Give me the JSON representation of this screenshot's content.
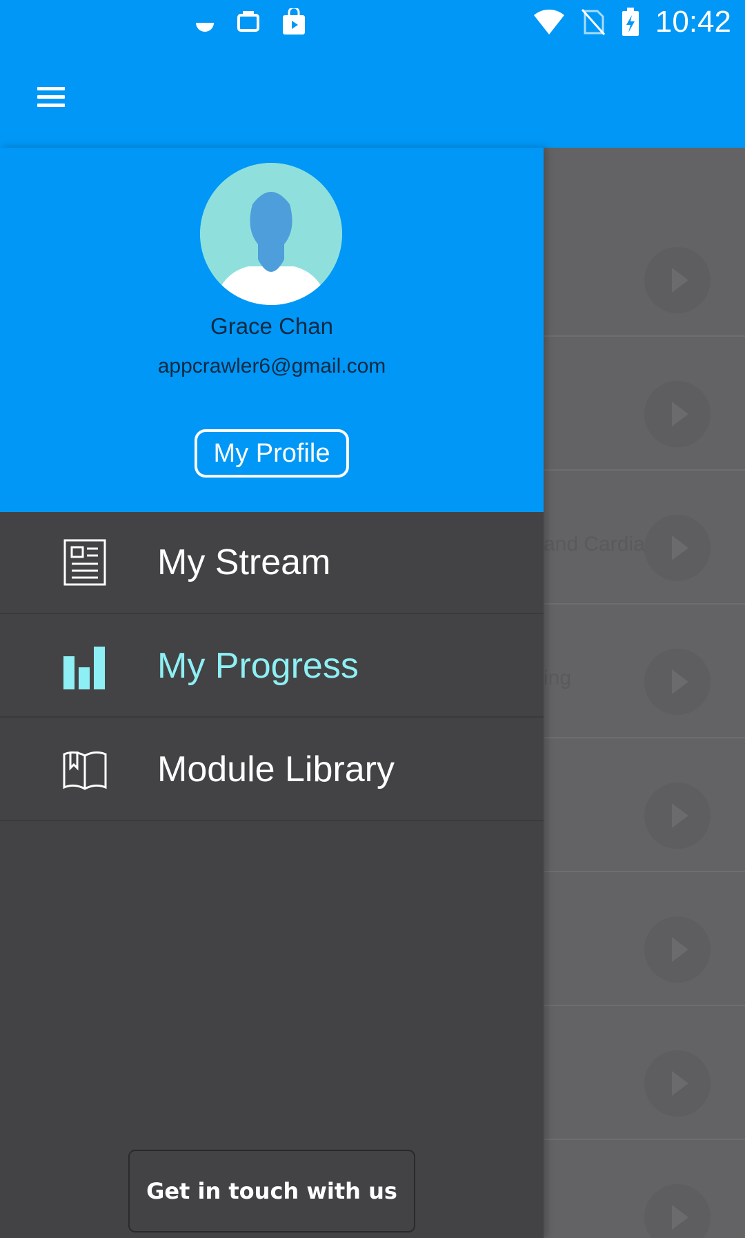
{
  "status_bar": {
    "time": "10:42",
    "icons_left": [
      "notification-icon",
      "screenshot-icon",
      "store-icon"
    ],
    "icons_right": [
      "wifi-icon",
      "no-sim-icon",
      "battery-charging-icon"
    ]
  },
  "toolbar": {
    "menu_icon": "hamburger-menu-icon"
  },
  "background_list": {
    "rows": [
      {
        "text": ""
      },
      {
        "text": ""
      },
      {
        "text": "and Cardiac"
      },
      {
        "text": "ing"
      },
      {
        "text": ""
      },
      {
        "text": ""
      },
      {
        "text": ""
      },
      {
        "text": ""
      }
    ]
  },
  "drawer": {
    "header": {
      "avatar_icon": "user-avatar-icon",
      "name": "Grace Chan",
      "email": "appcrawler6@gmail.com",
      "profile_button": "My Profile"
    },
    "menu": [
      {
        "label": "My Stream",
        "icon": "newspaper-icon",
        "active": false
      },
      {
        "label": "My Progress",
        "icon": "bar-chart-icon",
        "active": true
      },
      {
        "label": "Module Library",
        "icon": "book-icon",
        "active": false
      }
    ],
    "contact_button": "Get in touch with us"
  },
  "colors": {
    "primary": "#0197f6",
    "drawer_bg": "#434345",
    "active_text": "#8ef0f4",
    "scrim": "#636365"
  }
}
